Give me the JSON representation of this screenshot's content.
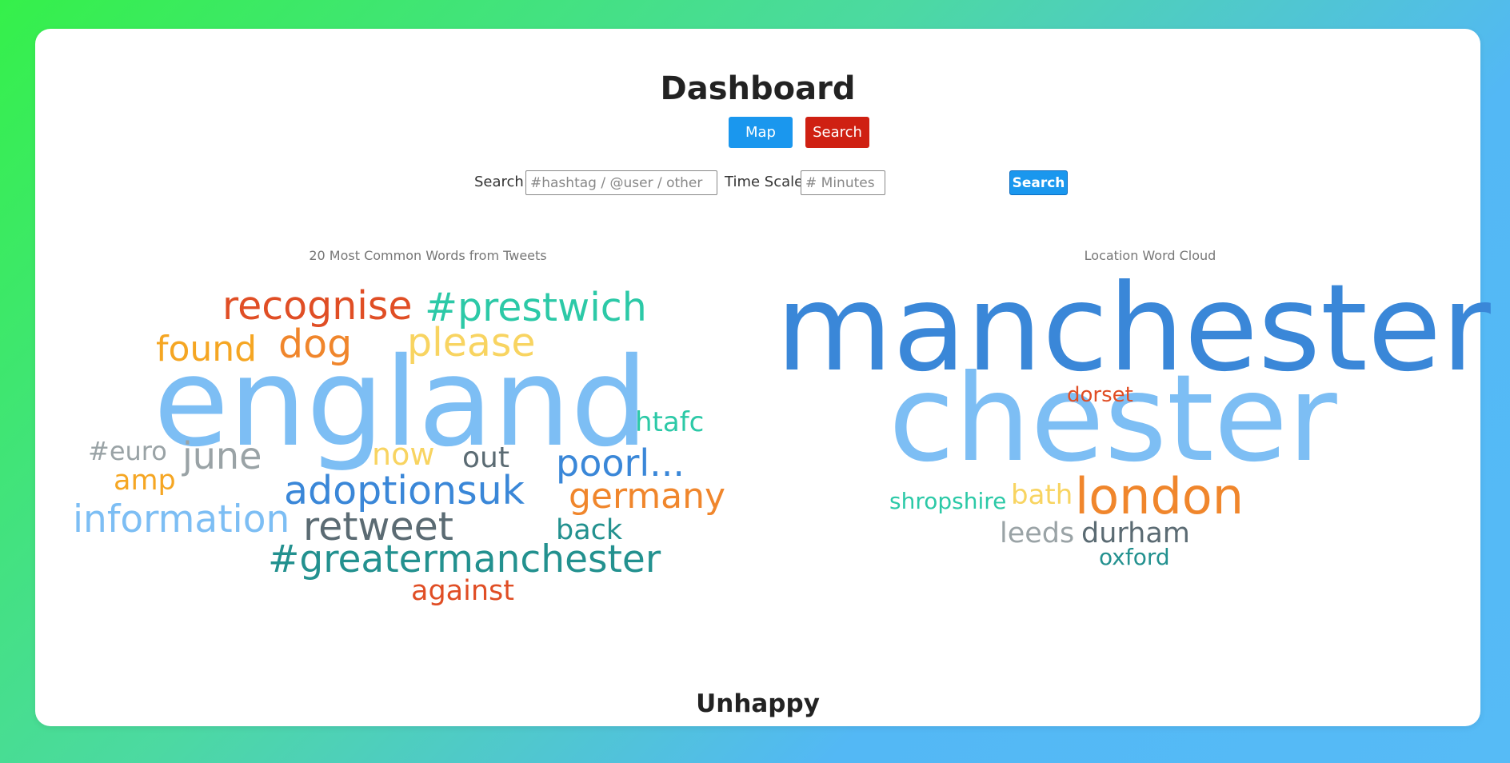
{
  "header": {
    "title": "Dashboard"
  },
  "nav": {
    "map_label": "Map",
    "search_label": "Search"
  },
  "search": {
    "search_label": "Search:",
    "search_placeholder": "#hashtag / @user / other",
    "timescale_label": "Time Scale:",
    "timescale_placeholder": "# Minutes",
    "button_label": "Search"
  },
  "tweets_cloud": {
    "title": "20 Most Common Words from Tweets",
    "words": [
      {
        "text": "england",
        "color": "#7dbef4"
      },
      {
        "text": "recognise",
        "color": "#e04e25"
      },
      {
        "text": "#prestwich",
        "color": "#2cc9a7"
      },
      {
        "text": "found",
        "color": "#f5a623"
      },
      {
        "text": "dog",
        "color": "#f0862c"
      },
      {
        "text": "please",
        "color": "#f8d461"
      },
      {
        "text": "htafc",
        "color": "#2cc9a7"
      },
      {
        "text": "#euro",
        "color": "#9aa3a6"
      },
      {
        "text": "june",
        "color": "#9aa3a6"
      },
      {
        "text": "now",
        "color": "#f8d461"
      },
      {
        "text": "out",
        "color": "#5b6b73"
      },
      {
        "text": "poorl...",
        "color": "#3a87d8"
      },
      {
        "text": "amp",
        "color": "#f5a623"
      },
      {
        "text": "adoptionsuk",
        "color": "#3a87d8"
      },
      {
        "text": "germany",
        "color": "#f0862c"
      },
      {
        "text": "information",
        "color": "#7dbef4"
      },
      {
        "text": "retweet",
        "color": "#5b6b73"
      },
      {
        "text": "back",
        "color": "#23918f"
      },
      {
        "text": "#greatermanchester",
        "color": "#23918f"
      },
      {
        "text": "against",
        "color": "#e04e25"
      }
    ]
  },
  "location_cloud": {
    "title": "Location Word Cloud",
    "words": [
      {
        "text": "manchester",
        "color": "#3a87d8"
      },
      {
        "text": "chester",
        "color": "#7dbef4"
      },
      {
        "text": "dorset",
        "color": "#e04e25"
      },
      {
        "text": "shropshire",
        "color": "#2cc9a7"
      },
      {
        "text": "bath",
        "color": "#f8d461"
      },
      {
        "text": "london",
        "color": "#f0862c"
      },
      {
        "text": "leeds",
        "color": "#9aa3a6"
      },
      {
        "text": "durham",
        "color": "#5b6b73"
      },
      {
        "text": "oxford",
        "color": "#23918f"
      }
    ]
  },
  "mood": {
    "label": "Unhappy"
  }
}
